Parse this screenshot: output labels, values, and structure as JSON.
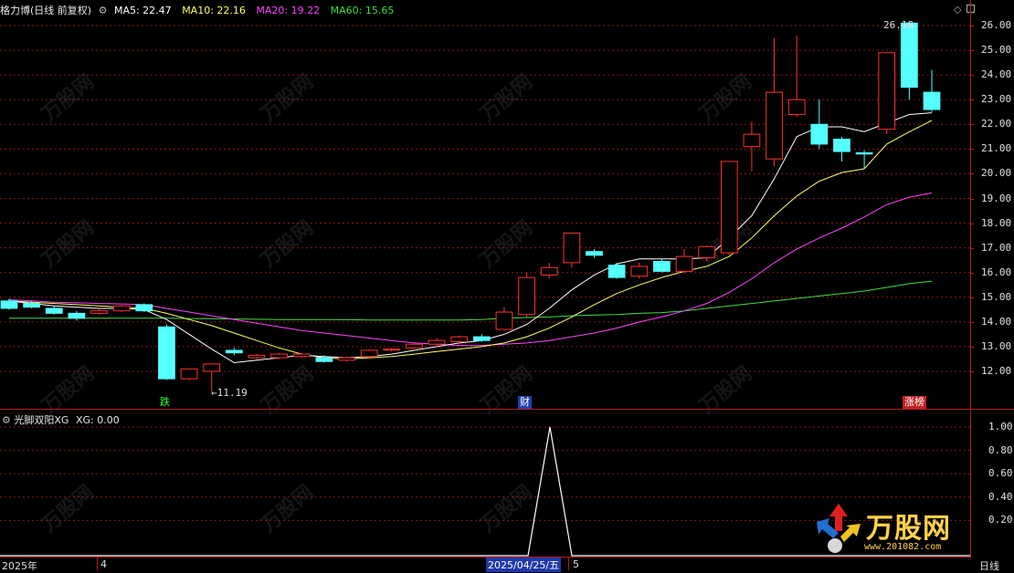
{
  "header": {
    "stock_title": "格力博(日线 前复权)",
    "ma": [
      {
        "label": "MA5: 22.47",
        "color": "#ffffff"
      },
      {
        "label": "MA10: 22.16",
        "color": "#ffff66"
      },
      {
        "label": "MA20: 19.22",
        "color": "#ff44ff"
      },
      {
        "label": "MA60: 15.65",
        "color": "#44dd44"
      }
    ]
  },
  "price_axis": {
    "ticks": [
      "26.00",
      "25.00",
      "24.00",
      "23.00",
      "22.00",
      "21.00",
      "20.00",
      "19.00",
      "18.00",
      "17.00",
      "16.00",
      "15.00",
      "14.00",
      "13.00",
      "12.00"
    ],
    "min": 11.0,
    "max": 26.0
  },
  "annotations": {
    "high_label": "26.18",
    "low_label": "←11.19",
    "marker_die": "跌",
    "marker_cai": "财",
    "marker_zhangbang": "涨榜"
  },
  "indicator": {
    "title": "光脚双阳XG",
    "value": "XG: 0.00",
    "ticks": [
      "1.00",
      "0.80",
      "0.60",
      "0.40",
      "0.20"
    ],
    "spike": {
      "date": "2025/04/25",
      "value": 1.0
    }
  },
  "time_axis": {
    "labels": [
      "2025年",
      "4",
      "2025/04/25/五",
      "5"
    ],
    "period": "日线"
  },
  "colors": {
    "up": "#ff3232",
    "down": "#54ffff",
    "grid": "#8b1a1a",
    "axis": "#b02020"
  },
  "chart_data": {
    "type": "candlestick",
    "candles": [
      {
        "o": 14.85,
        "h": 14.95,
        "c": 14.55,
        "l": 14.5
      },
      {
        "o": 14.75,
        "h": 14.85,
        "c": 14.6,
        "l": 14.55
      },
      {
        "o": 14.55,
        "h": 14.65,
        "c": 14.35,
        "l": 14.3
      },
      {
        "o": 14.35,
        "h": 14.45,
        "c": 14.15,
        "l": 14.05
      },
      {
        "o": 14.35,
        "h": 14.55,
        "c": 14.45,
        "l": 14.3
      },
      {
        "o": 14.45,
        "h": 14.7,
        "c": 14.65,
        "l": 14.4
      },
      {
        "o": 14.7,
        "h": 14.75,
        "c": 14.45,
        "l": 14.4
      },
      {
        "o": 13.8,
        "h": 13.9,
        "c": 11.7,
        "l": 11.65
      },
      {
        "o": 11.7,
        "h": 12.1,
        "c": 12.1,
        "l": 11.65
      },
      {
        "o": 12.0,
        "h": 12.3,
        "c": 12.3,
        "l": 11.19
      },
      {
        "o": 12.85,
        "h": 12.95,
        "c": 12.75,
        "l": 12.65
      },
      {
        "o": 12.55,
        "h": 12.7,
        "c": 12.65,
        "l": 12.5
      },
      {
        "o": 12.55,
        "h": 12.75,
        "c": 12.7,
        "l": 12.5
      },
      {
        "o": 12.6,
        "h": 12.75,
        "c": 12.7,
        "l": 12.55
      },
      {
        "o": 12.55,
        "h": 12.65,
        "c": 12.4,
        "l": 12.35
      },
      {
        "o": 12.45,
        "h": 12.6,
        "c": 12.55,
        "l": 12.4
      },
      {
        "o": 12.6,
        "h": 12.9,
        "c": 12.85,
        "l": 12.55
      },
      {
        "o": 12.9,
        "h": 12.95,
        "c": 12.9,
        "l": 12.8
      },
      {
        "o": 12.95,
        "h": 13.15,
        "c": 13.1,
        "l": 12.9
      },
      {
        "o": 13.1,
        "h": 13.35,
        "c": 13.25,
        "l": 12.95
      },
      {
        "o": 13.2,
        "h": 13.45,
        "c": 13.4,
        "l": 13.1
      },
      {
        "o": 13.4,
        "h": 13.5,
        "c": 13.25,
        "l": 13.2
      },
      {
        "o": 13.7,
        "h": 14.6,
        "c": 14.4,
        "l": 13.65
      },
      {
        "o": 14.3,
        "h": 16.0,
        "c": 15.8,
        "l": 14.2
      },
      {
        "o": 15.9,
        "h": 16.4,
        "c": 16.2,
        "l": 15.75
      },
      {
        "o": 16.4,
        "h": 17.4,
        "c": 17.6,
        "l": 16.2
      },
      {
        "o": 16.85,
        "h": 16.95,
        "c": 16.7,
        "l": 16.6
      },
      {
        "o": 16.3,
        "h": 16.4,
        "c": 15.8,
        "l": 15.75
      },
      {
        "o": 15.85,
        "h": 16.4,
        "c": 16.25,
        "l": 15.75
      },
      {
        "o": 16.45,
        "h": 16.55,
        "c": 16.05,
        "l": 16.0
      },
      {
        "o": 16.05,
        "h": 16.95,
        "c": 16.65,
        "l": 15.95
      },
      {
        "o": 16.6,
        "h": 17.1,
        "c": 17.05,
        "l": 16.45
      },
      {
        "o": 16.8,
        "h": 20.5,
        "c": 20.5,
        "l": 16.7
      },
      {
        "o": 21.1,
        "h": 22.1,
        "c": 21.6,
        "l": 20.1
      },
      {
        "o": 20.6,
        "h": 25.5,
        "c": 23.3,
        "l": 20.3
      },
      {
        "o": 22.4,
        "h": 25.6,
        "c": 23.0,
        "l": 22.3
      },
      {
        "o": 22.0,
        "h": 23.0,
        "c": 21.2,
        "l": 21.0
      },
      {
        "o": 21.4,
        "h": 21.5,
        "c": 20.9,
        "l": 20.5
      },
      {
        "o": 20.85,
        "h": 20.95,
        "c": 20.8,
        "l": 20.2
      },
      {
        "o": 21.8,
        "h": 24.9,
        "c": 24.9,
        "l": 21.6
      },
      {
        "o": 26.1,
        "h": 26.18,
        "c": 23.5,
        "l": 23.0
      },
      {
        "o": 23.3,
        "h": 24.2,
        "c": 22.6,
        "l": 22.5
      }
    ],
    "ma5": [
      14.85,
      14.75,
      14.65,
      14.6,
      14.55,
      14.55,
      14.5,
      14.1,
      13.5,
      12.9,
      12.35,
      12.45,
      12.55,
      12.65,
      12.6,
      12.55,
      12.6,
      12.7,
      12.85,
      13.0,
      13.15,
      13.25,
      13.5,
      13.9,
      14.55,
      15.3,
      15.9,
      16.35,
      16.55,
      16.55,
      16.55,
      16.6,
      17.4,
      18.3,
      19.8,
      21.5,
      21.9,
      21.9,
      21.7,
      22.05,
      22.4,
      22.47
    ],
    "ma10": [
      14.85,
      14.8,
      14.75,
      14.7,
      14.65,
      14.6,
      14.55,
      14.35,
      14.1,
      13.85,
      13.55,
      13.25,
      12.95,
      12.7,
      12.55,
      12.5,
      12.55,
      12.6,
      12.7,
      12.8,
      12.9,
      13.0,
      13.15,
      13.4,
      13.75,
      14.2,
      14.7,
      15.15,
      15.5,
      15.8,
      16.05,
      16.25,
      16.65,
      17.4,
      18.3,
      19.1,
      19.7,
      20.05,
      20.2,
      21.2,
      21.7,
      22.16
    ],
    "ma20": [
      14.9,
      14.85,
      14.8,
      14.78,
      14.75,
      14.73,
      14.7,
      14.55,
      14.4,
      14.25,
      14.1,
      13.95,
      13.8,
      13.65,
      13.55,
      13.45,
      13.35,
      13.25,
      13.15,
      13.1,
      13.05,
      13.05,
      13.1,
      13.15,
      13.25,
      13.4,
      13.55,
      13.75,
      14.0,
      14.2,
      14.45,
      14.75,
      15.2,
      15.75,
      16.4,
      16.95,
      17.4,
      17.8,
      18.25,
      18.75,
      19.05,
      19.22
    ],
    "ma60": [
      14.15,
      14.15,
      14.15,
      14.15,
      14.15,
      14.15,
      14.15,
      14.15,
      14.14,
      14.13,
      14.12,
      14.11,
      14.1,
      14.1,
      14.1,
      14.09,
      14.08,
      14.08,
      14.08,
      14.08,
      14.08,
      14.1,
      14.15,
      14.18,
      14.2,
      14.25,
      14.28,
      14.3,
      14.35,
      14.38,
      14.45,
      14.55,
      14.65,
      14.75,
      14.85,
      14.95,
      15.05,
      15.15,
      15.25,
      15.4,
      15.55,
      15.65
    ]
  }
}
